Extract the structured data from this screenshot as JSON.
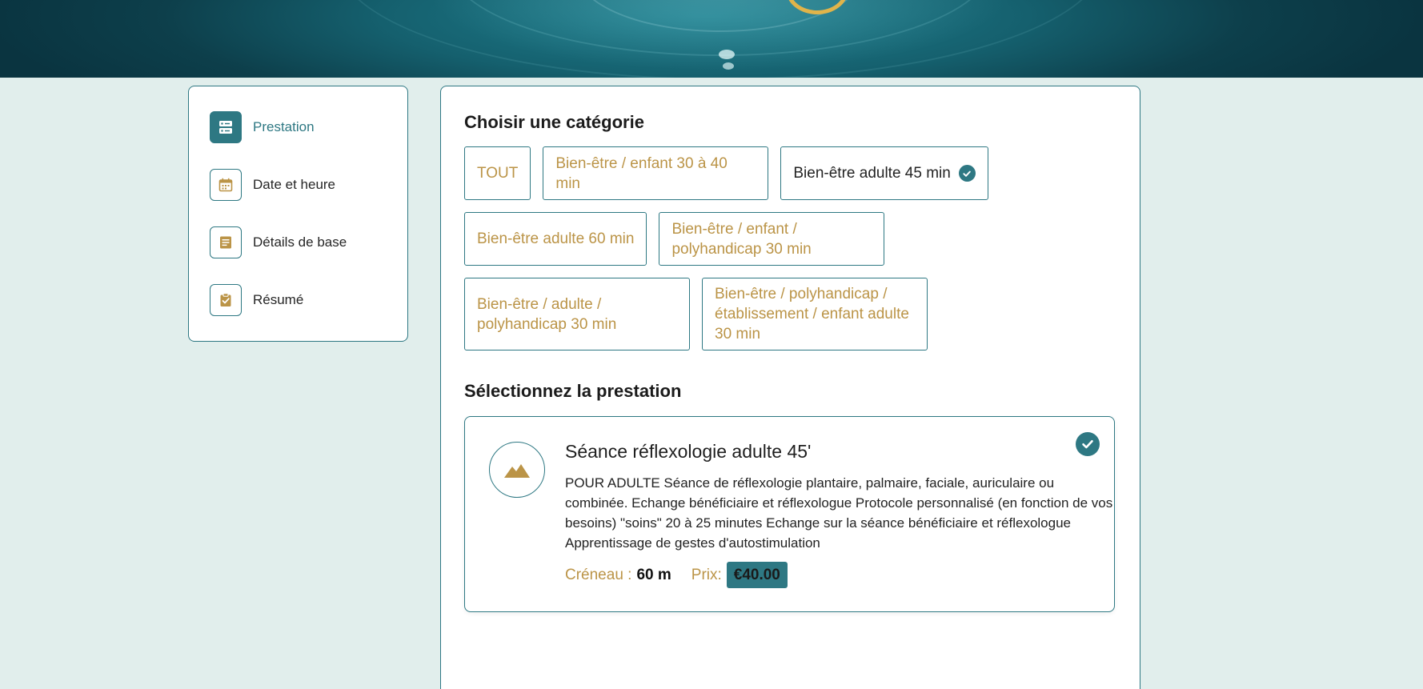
{
  "steps": [
    {
      "label": "Prestation",
      "icon": "server-icon",
      "active": true
    },
    {
      "label": "Date et heure",
      "icon": "calendar-icon",
      "active": false
    },
    {
      "label": "Détails de base",
      "icon": "document-icon",
      "active": false
    },
    {
      "label": "Résumé",
      "icon": "clipboard-check-icon",
      "active": false
    }
  ],
  "categories_section": {
    "title": "Choisir une catégorie",
    "items": [
      {
        "label": "TOUT",
        "selected": false
      },
      {
        "label": "Bien-être / enfant 30 à 40 min",
        "selected": false
      },
      {
        "label": "Bien-être adulte 45 min",
        "selected": true
      },
      {
        "label": "Bien-être adulte 60 min",
        "selected": false
      },
      {
        "label": "Bien-être / enfant / polyhandicap 30 min",
        "selected": false
      },
      {
        "label": "Bien-être / adulte / polyhandicap 30 min",
        "selected": false
      },
      {
        "label": "Bien-être / polyhandicap / établissement / enfant adulte 30 min",
        "selected": false
      }
    ]
  },
  "services_section": {
    "title": "Sélectionnez la prestation",
    "service": {
      "title": "Séance réflexologie adulte 45'",
      "description": "POUR ADULTE Séance de réflexologie plantaire, palmaire, faciale, auriculaire ou combinée. Echange bénéficiaire et réflexologue Protocole personnalisé (en fonction de vos besoins) \"soins\" 20 à 25 minutes Echange sur la séance bénéficiaire et réflexologue Apprentissage de gestes d'autostimulation",
      "slot_label": "Créneau :",
      "slot_value": "60 m",
      "price_label": "Prix:",
      "price_value": "€40.00",
      "image_icon": "mountain-image-icon",
      "selected": true
    }
  },
  "colors": {
    "accent": "#2e7883",
    "gold": "#bb9447",
    "background": "#e1eeec"
  }
}
